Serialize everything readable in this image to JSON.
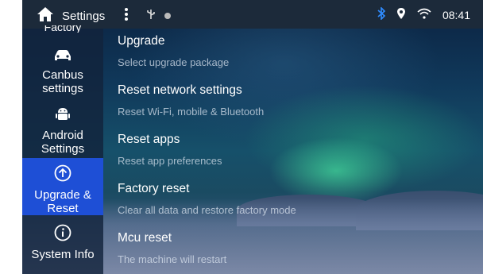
{
  "status_bar": {
    "title": "Settings",
    "time": "08:41"
  },
  "sidebar": {
    "partial_item": "Factory",
    "items": [
      {
        "label_line1": "Canbus",
        "label_line2": "settings",
        "icon": "car-icon"
      },
      {
        "label_line1": "Android",
        "label_line2": "Settings",
        "icon": "android-icon"
      },
      {
        "label_line1": "Upgrade &",
        "label_line2": "Reset",
        "icon": "upgrade-icon",
        "active": true
      },
      {
        "label_line1": "System Info",
        "label_line2": "",
        "icon": "info-icon"
      }
    ]
  },
  "entries": [
    {
      "title": "Upgrade",
      "subtitle": "Select upgrade package"
    },
    {
      "title": "Reset network settings",
      "subtitle": "Reset Wi-Fi, mobile & Bluetooth"
    },
    {
      "title": "Reset apps",
      "subtitle": "Reset app preferences"
    },
    {
      "title": "Factory reset",
      "subtitle": "Clear all data and restore factory mode"
    },
    {
      "title": "Mcu reset",
      "subtitle": "The machine will restart"
    }
  ],
  "colors": {
    "active_item": "#1e4fd6",
    "bluetooth": "#2f8cff"
  }
}
